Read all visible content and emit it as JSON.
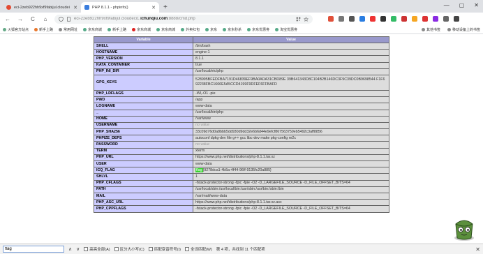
{
  "tabs": [
    {
      "title": "eci-2zeb922hh9xf9fabijul.cloudei",
      "active": false
    },
    {
      "title": "PHP 8.1.1 - phpinfo()",
      "active": true
    }
  ],
  "new_tab_symbol": "+",
  "window_controls": {
    "minimize": "—",
    "maximize": "▢",
    "close": "✕"
  },
  "nav": {
    "back": "←",
    "forward": "→",
    "reload": "C",
    "home": "⌂"
  },
  "url": {
    "host_dim": "eci-2zeb922hh9xf9fabijul.cloudeci1.",
    "host_bold": "ichunqiu.com",
    "path": ":8888/cmd.php"
  },
  "bookmarks": {
    "left": [
      "火狐官方站点",
      "新手上路",
      "常用网址",
      "京东商城",
      "新手上路",
      "京东商城",
      "京东商城",
      "外卖红包",
      "京东",
      "京东秒杀",
      "京东优惠劵",
      "淘宝优惠劵"
    ],
    "right": [
      "其他书签",
      "移动设备上的书签"
    ]
  },
  "table": {
    "header_variable": "Variable",
    "header_value": "Value",
    "rows": [
      {
        "name": "SHELL",
        "value": "/bin/bash"
      },
      {
        "name": "HOSTNAME",
        "value": "engine-1"
      },
      {
        "name": "PHP_VERSION",
        "value": "8.1.1"
      },
      {
        "name": "KATA_CONTAINER",
        "value": "true"
      },
      {
        "name": "PHP_INI_DIR",
        "value": "/usr/local/etc/php"
      },
      {
        "name": "GPG_KEYS",
        "value": "528995BFEDFBA7191D46839EF9BA0ADA31CBD89E 39B641343D8C104B2B146DC3F9C39DC0B9698544 F1F692238FBC1666E5A5CCD4199F9DFEF6FFBAFD",
        "tall": true
      },
      {
        "name": "PHP_LDFLAGS",
        "value": "-Wl,-O1 -pie"
      },
      {
        "name": "PWD",
        "value": "/app"
      },
      {
        "name": "LOGNAME",
        "value": "www-data"
      },
      {
        "name": "_",
        "value": "/usr/local/bin/php"
      },
      {
        "name": "HOME",
        "value": "/var/www"
      },
      {
        "name": "USERNAME",
        "value": "no value",
        "novalue": true
      },
      {
        "name": "PHP_SHA256",
        "value": "33c09d76d0a8bbb5dd930d9dd32e6b6d44e9efcf867563759eb5492c3aff8856"
      },
      {
        "name": "PHPIZE_DEPS",
        "value": "autoconf dpkg-dev file g++ gcc libc-dev make pkg-config re2c"
      },
      {
        "name": "PASSWORD",
        "value": "no value",
        "novalue": true
      },
      {
        "name": "TERM",
        "value": "xterm"
      },
      {
        "name": "PHP_URL",
        "value": "https://www.php.net/distributions/php-8.1.1.tar.xz"
      },
      {
        "name": "USER",
        "value": "www-data"
      },
      {
        "name": "ICQ_FLAG",
        "value": "{9278dca1-4b5a-4f44-96ff-9135fc20a885}",
        "highlight": "flag"
      },
      {
        "name": "SHLVL",
        "value": "1"
      },
      {
        "name": "PHP_CFLAGS",
        "value": "-fstack-protector-strong -fpic -fpie -O2 -D_LARGEFILE_SOURCE -D_FILE_OFFSET_BITS=64"
      },
      {
        "name": "PATH",
        "value": "/usr/local/sbin:/usr/local/bin:/usr/sbin:/usr/bin:/sbin:/bin"
      },
      {
        "name": "MAIL",
        "value": "/var/mail/www-data"
      },
      {
        "name": "PHP_ASC_URL",
        "value": "https://www.php.net/distributions/php-8.1.1.tar.xz.asc"
      },
      {
        "name": "PHP_CPPFLAGS",
        "value": "-fstack-protector-strong -fpic -fpie -O2 -D_LARGEFILE_SOURCE -D_FILE_OFFSET_BITS=64"
      }
    ]
  },
  "findbar": {
    "query": "flag",
    "up": "∧",
    "down": "∨",
    "options": [
      "高亮全部(A)",
      "区分大小写(C)",
      "匹配变音符号(I)",
      "全词匹配(W)"
    ],
    "status": "第 4 项，共找到 11 个匹配项",
    "close": "✕"
  },
  "colors": {
    "table_header": "#9999cc",
    "name_cell": "#ccccff",
    "value_cell": "#dddddd",
    "highlight": "#38d430"
  }
}
